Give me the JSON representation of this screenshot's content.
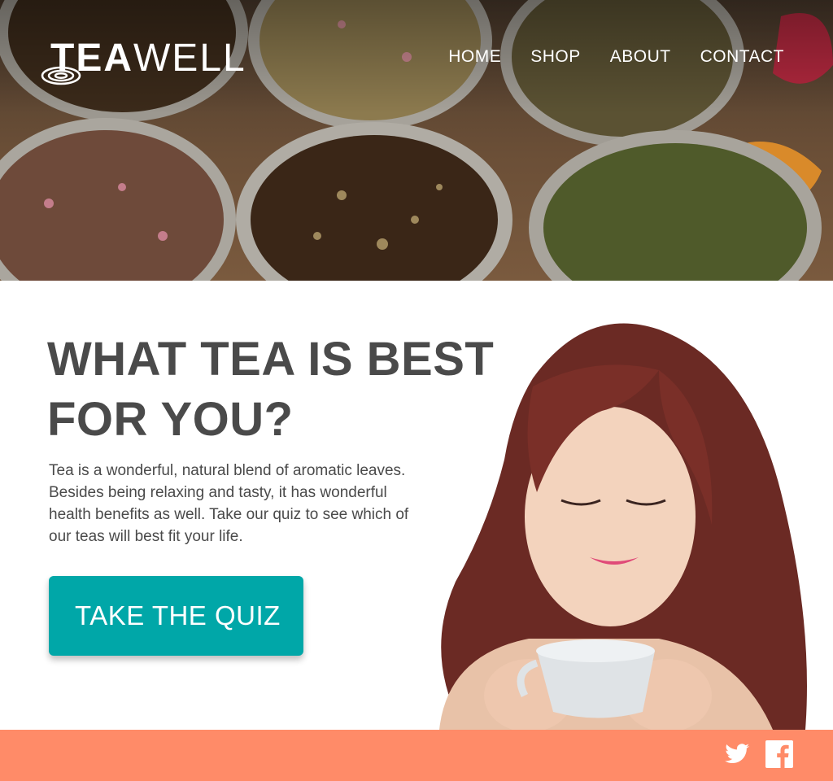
{
  "header": {
    "logo": {
      "bold": "TEA",
      "light": "WELL"
    },
    "nav": [
      "HOME",
      "SHOP",
      "ABOUT",
      "CONTACT"
    ]
  },
  "main": {
    "headline": "WHAT TEA IS BEST FOR YOU?",
    "body": "Tea is a wonderful, natural blend of aromatic leaves. Besides being relaxing and tasty, it has wonderful health benefits as well. Take our quiz to see which of our teas will best fit your life.",
    "cta_label": "TAKE THE QUIZ"
  },
  "footer": {
    "social_icons": [
      "twitter-icon",
      "facebook-icon"
    ]
  },
  "colors": {
    "accent": "#00a7a8",
    "footer": "#ff8b68",
    "text": "#4a4a4a"
  }
}
